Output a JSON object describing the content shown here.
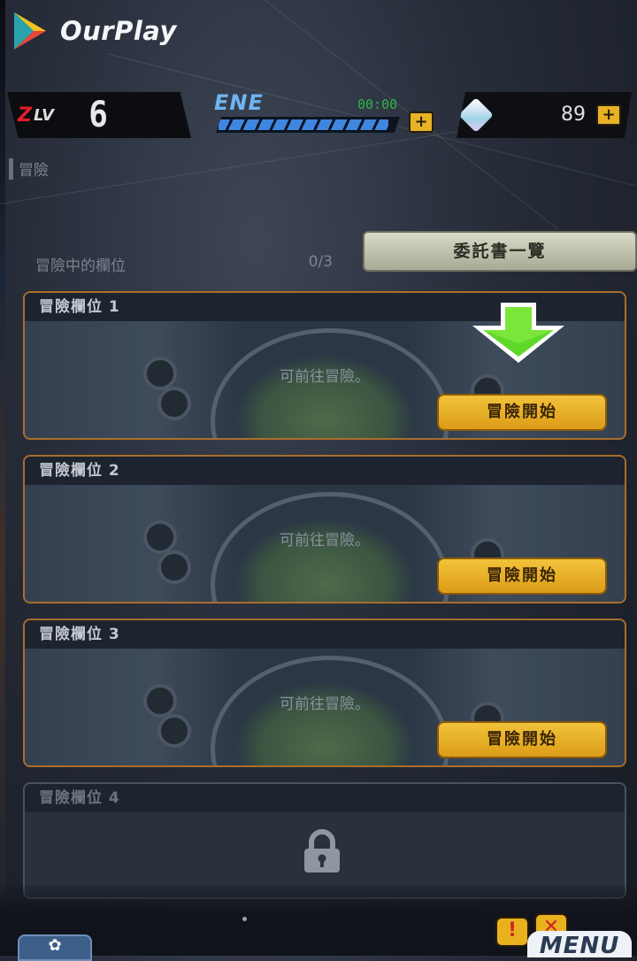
{
  "branding": {
    "name": "OurPlay"
  },
  "hud": {
    "lv_label": "LV",
    "level": "6",
    "ene_label": "ENE",
    "ene_timer": "00:00",
    "ene_fill_fraction": 0.95,
    "gem_count": "89",
    "plus_symbol": "+"
  },
  "section": {
    "title": "冒險"
  },
  "adventure": {
    "slots_label": "冒險中的欄位",
    "slots_count": "0/3",
    "commission_list_button": "委託書一覽"
  },
  "slots": [
    {
      "title": "冒險欄位 1",
      "message": "可前往冒險。",
      "button": "冒險開始"
    },
    {
      "title": "冒險欄位 2",
      "message": "可前往冒險。",
      "button": "冒險開始"
    },
    {
      "title": "冒險欄位 3",
      "message": "可前往冒險。",
      "button": "冒險開始"
    },
    {
      "title": "冒險欄位 4",
      "locked": true
    }
  ],
  "bottom": {
    "menu_label": "MENU",
    "alert_1": "!",
    "alert_2": "✕",
    "home_glyph": "✿"
  },
  "icons": [
    "ourplay-logo-icon",
    "gem-icon",
    "plus-icon",
    "lock-icon",
    "down-arrow-icon",
    "alert-icon"
  ],
  "colors": {
    "accent_gold": "#e7b325",
    "slot_border": "#a96e2a",
    "ene_blue": "#3f86e0",
    "arrow_green": "#5fd82a",
    "lv_red": "#e01e2a"
  }
}
